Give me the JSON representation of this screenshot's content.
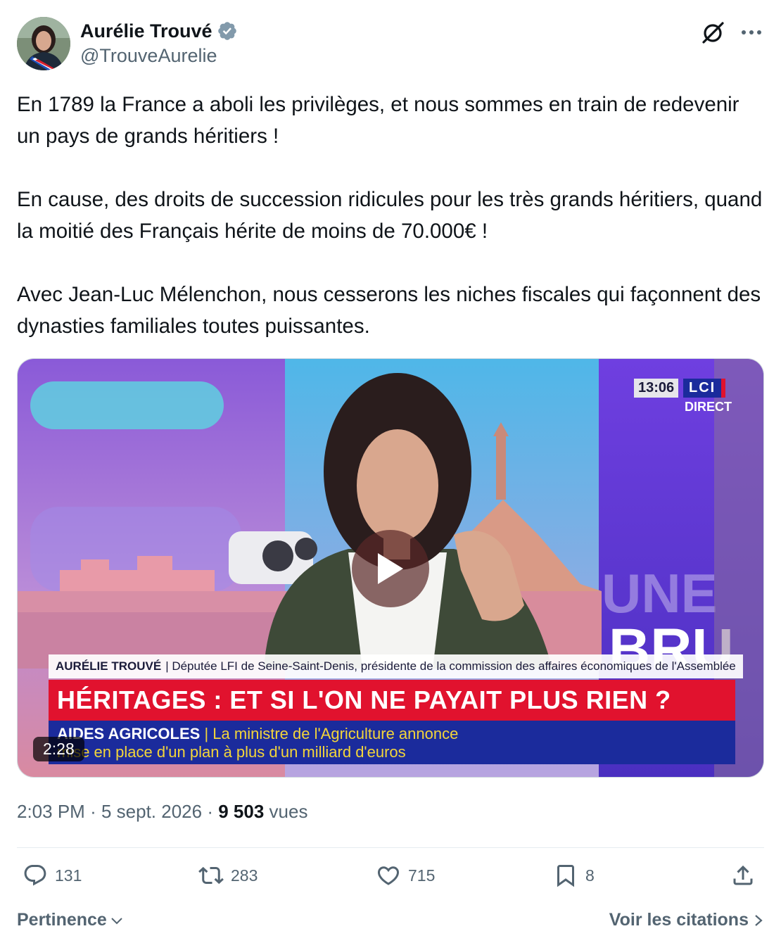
{
  "author": {
    "name": "Aurélie Trouvé",
    "handle": "@TrouveAurelie",
    "verified": true
  },
  "tweet": {
    "paragraphs": [
      "En 1789 la France a aboli les privilèges, et nous sommes en train de redevenir un pays de grands héritiers !",
      "En cause, des droits de succession ridicules pour les très grands héritiers, quand la moitié des Français hérite de moins de 70.000€ !",
      "Avec Jean-Luc Mélenchon, nous cesserons les niches fiscales qui façonnent des dynasties familiales toutes puissantes."
    ]
  },
  "video": {
    "duration": "2:28",
    "channel_clock": "13:06",
    "channel_logo": "LCI",
    "channel_status": "DIRECT",
    "lower_third_name": "AURÉLIE TROUVÉ",
    "lower_third_title": "| Députée LFI de Seine-Saint-Denis, présidente de la commission des affaires économiques de l'Assemblée",
    "headline": "HÉRITAGES : ET SI L'ON NE PAYAIT PLUS RIEN ?",
    "ticker_label": "AIDES AGRICOLES",
    "ticker_line1": "| La ministre de l'Agriculture annonce",
    "ticker_line2": "mise en place d'un plan à plus d'un milliard d'euros",
    "backdrop_text_1": "BRU",
    "backdrop_text_2": "UNE"
  },
  "meta": {
    "time": "2:03 PM",
    "separator": "·",
    "date": "5 sept. 2026",
    "views_count": "9 503",
    "views_label": "vues"
  },
  "actions": {
    "replies": "131",
    "reposts": "283",
    "likes": "715",
    "bookmarks": "8"
  },
  "footer": {
    "sort_label": "Pertinence",
    "quotes_label": "Voir les citations"
  },
  "colors": {
    "text_primary": "#0f1419",
    "text_secondary": "#536471",
    "verified": "#829aab",
    "lci_red": "#e1122e",
    "lci_blue": "#1b2b9c"
  }
}
